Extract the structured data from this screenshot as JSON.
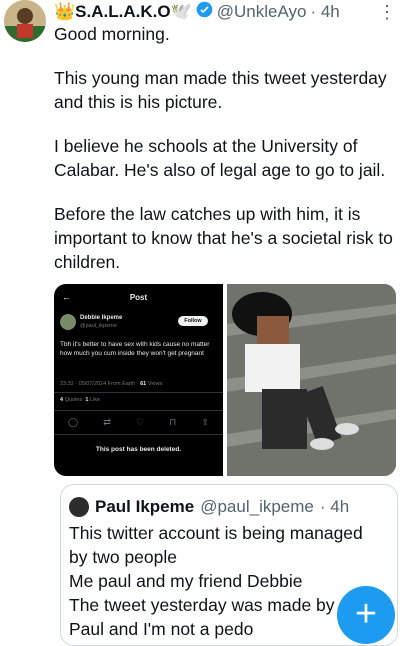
{
  "tweet": {
    "display_name": "👑S.A.L.A.K.O🕊️",
    "verified_icon": "verified-badge-icon",
    "handle": "@UnkleAyo",
    "time": "· 4h",
    "more_icon": "more-icon",
    "paragraphs": [
      "Good morning.",
      "This young man made this tweet yesterday and this is his picture.",
      "I believe he schools at the University of Calabar. He's also of legal age to go to jail.",
      "Before the law catches up with him, it is important to know that he's a societal risk to children."
    ]
  },
  "screenshot": {
    "back_icon": "arrow-left-icon",
    "title": "Post",
    "author_name": "Debbie Ikpeme",
    "author_handle": "@paul_ikpeme",
    "follow_label": "Follow",
    "text": "Tbh it's better to have sex with kids cause no matter how much you cum inside they won't get pregnant",
    "meta": "23:32 · 05/07/2024 From Earth ·",
    "views_count": "61",
    "views_label": "Views",
    "quotes_count": "4",
    "quotes_label": "Quotes",
    "likes_count": "1",
    "likes_label": "Like",
    "action_icons": [
      "reply-icon",
      "retweet-icon",
      "like-icon",
      "bookmark-icon",
      "share-icon"
    ],
    "deleted_text": "This post has been deleted."
  },
  "quote": {
    "display_name": "Paul Ikpeme",
    "handle": "@paul_ikpeme",
    "time": "· 4h",
    "lines": [
      "This twitter account is being managed",
      "by two people",
      "Me paul and my friend Debbie",
      "The tweet yesterday was made by",
      "Paul and I'm not a pedo"
    ]
  },
  "fab": {
    "label": "+",
    "icon": "compose-icon"
  },
  "colors": {
    "accent": "#1d9bf0",
    "secondary_text": "#536471",
    "border": "#cfd9de"
  }
}
